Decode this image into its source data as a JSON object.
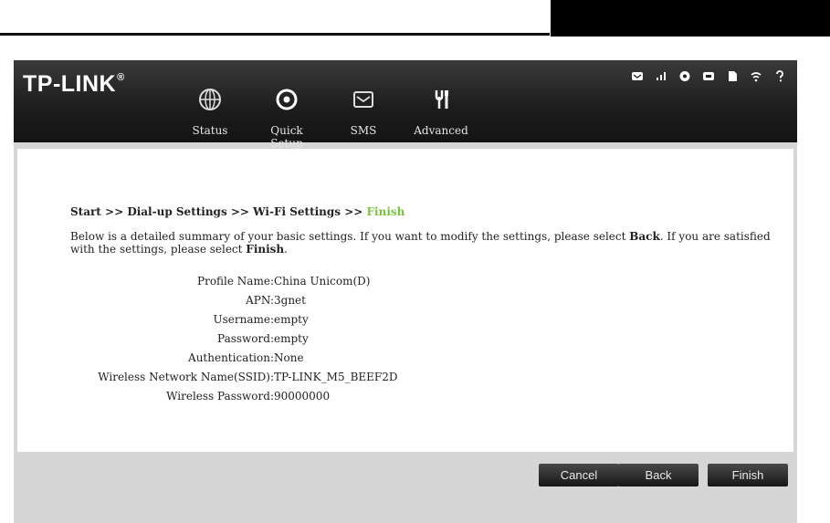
{
  "brand": {
    "logo": "TP-LINK",
    "reg": "®"
  },
  "nav": {
    "items": [
      {
        "label": "Status",
        "icon": "globe-icon"
      },
      {
        "label": "Quick Setup",
        "icon": "target-icon"
      },
      {
        "label": "SMS",
        "icon": "envelope-icon"
      },
      {
        "label": "Advanced",
        "icon": "tools-icon"
      }
    ],
    "active": "Quick Setup"
  },
  "status_icons": [
    "mail-icon",
    "signal-icon",
    "globe-icon",
    "battery-icon",
    "sim-card-icon",
    "wifi-icon",
    "help-icon"
  ],
  "breadcrumb": {
    "steps": "Start >> Dial-up Settings >> Wi-Fi Settings >> ",
    "current": "Finish"
  },
  "intro": {
    "text_a": "Below is a detailed summary of your basic settings. If you want to modify the settings, please select ",
    "back": "Back",
    "text_b": ". If you are satisfied with the settings, please select ",
    "finish": "Finish",
    "text_c": "."
  },
  "summary": [
    {
      "label": "Profile Name:",
      "value": "China Unicom(D)"
    },
    {
      "label": "APN:",
      "value": "3gnet"
    },
    {
      "label": "Username:",
      "value": "empty"
    },
    {
      "label": "Password:",
      "value": "empty"
    },
    {
      "label": "Authentication:",
      "value": "None"
    },
    {
      "label": "Wireless Network Name(SSID):",
      "value": "TP-LINK_M5_BEEF2D"
    },
    {
      "label": "Wireless Password:",
      "value": "90000000"
    }
  ],
  "buttons": {
    "cancel": "Cancel",
    "back": "Back",
    "finish": "Finish"
  },
  "colors": {
    "accent_green": "#7ac142",
    "header_bg": "#1c1c1c",
    "frame_bg": "#d6d6d6"
  }
}
